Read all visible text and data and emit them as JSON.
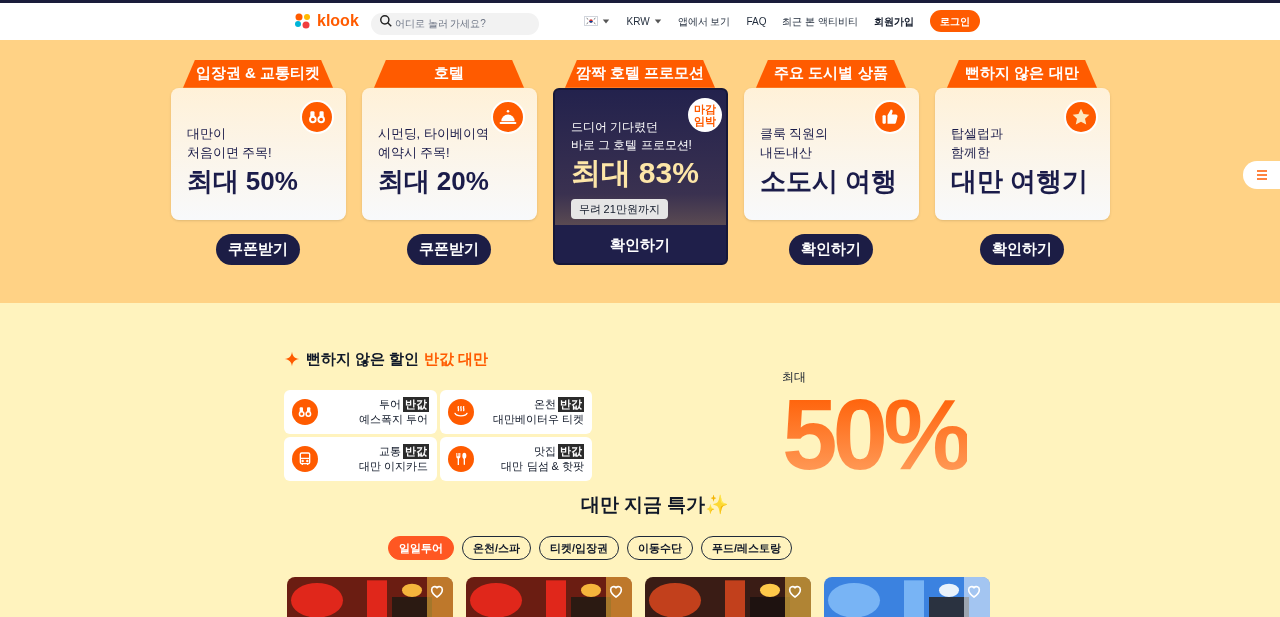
{
  "header": {
    "logo": "klook",
    "search": {
      "placeholder": "어디로 놀러 가세요?"
    },
    "nav": [
      {
        "kind": "flag"
      },
      {
        "kind": "dropdown",
        "label": "KRW"
      },
      {
        "kind": "link",
        "label": "앱에서 보기"
      },
      {
        "kind": "link",
        "label": "FAQ"
      },
      {
        "kind": "link",
        "label": "최근 본 액티비티"
      },
      {
        "kind": "strong",
        "label": "회원가입"
      }
    ],
    "login": "로그인"
  },
  "promos": [
    {
      "kind": "coupon",
      "tab": "입장권 & 교통티켓",
      "lines": [
        "대만이",
        "처음이면 주목!"
      ],
      "headline": "최대 50%",
      "button": "쿠폰받기"
    },
    {
      "kind": "coupon",
      "tab": "호텔",
      "lines": [
        "시먼딩, 타이베이역",
        "예약시 주목!"
      ],
      "headline": "최대 20%",
      "button": "쿠폰받기"
    },
    {
      "kind": "featured",
      "tab": "깜짝 호텔 프로모션",
      "badge": [
        "마감",
        "임박"
      ],
      "lines": [
        "드디어 기다렸던",
        "바로 그 호텔 프로모션!"
      ],
      "headline": "최대 83%",
      "note": "무려 21만원까지",
      "button": "확인하기"
    },
    {
      "kind": "coupon",
      "tab": "주요 도시별 상품",
      "lines": [
        "클룩 직원의",
        "내돈내산"
      ],
      "headline": "소도시 여행",
      "button": "확인하기"
    },
    {
      "kind": "coupon",
      "tab": "뻔하지 않은 대만",
      "lines": [
        "탑셀럽과",
        "함께한"
      ],
      "headline": "대만 여행기",
      "button": "확인하기"
    }
  ],
  "half_price": {
    "title": "뻔하지 않은 할인",
    "highlight": "반값 대만",
    "items": [
      {
        "label": "투어",
        "badge": "반값",
        "title": "예스폭지 투어"
      },
      {
        "label": "온천",
        "badge": "반값",
        "title": "대만베이터우 티켓"
      },
      {
        "label": "교통",
        "badge": "반값",
        "title": "대만 이지카드"
      },
      {
        "label": "맛집",
        "badge": "반값",
        "title": "대만 딤섬 & 핫팟"
      }
    ],
    "big_label": "최대",
    "big_value": "50%"
  },
  "deals": {
    "title": "대만 지금 특가✨",
    "tabs": [
      {
        "label": "일일투어",
        "selected": true
      },
      {
        "label": "온천/스파",
        "selected": false
      },
      {
        "label": "티켓/입장권",
        "selected": false
      },
      {
        "label": "이동수단",
        "selected": false
      },
      {
        "label": "푸드/레스토랑",
        "selected": false
      }
    ]
  }
}
